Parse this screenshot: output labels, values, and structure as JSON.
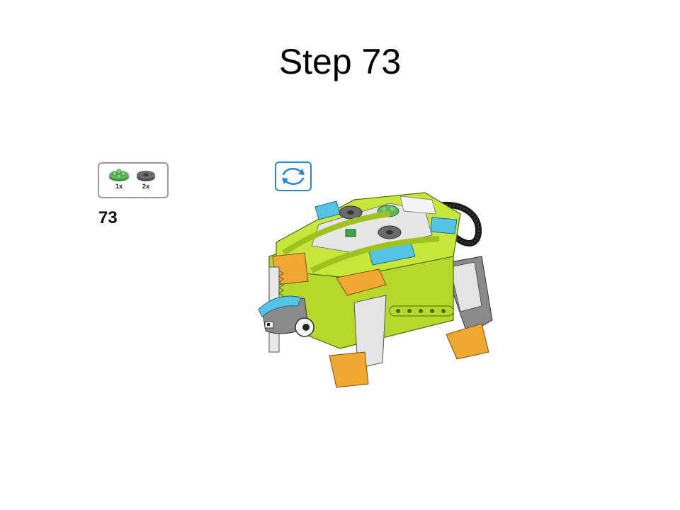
{
  "slide": {
    "title": "Step 73"
  },
  "parts_callout": {
    "parts": [
      {
        "qty": "1x",
        "color": "#5cb85c",
        "icon": "green-round-plate-icon"
      },
      {
        "qty": "2x",
        "color": "#6a6a6a",
        "icon": "gray-round-tile-icon"
      }
    ]
  },
  "step": {
    "number": "73"
  },
  "rotate": {
    "icon": "rotate-arrows-icon",
    "color": "#2a86c8"
  },
  "model": {
    "description": "turtle",
    "colors": {
      "lime": "#b5d82a",
      "azure": "#55c3e3",
      "orange": "#f0a830",
      "gray": "#8a8a8a",
      "white": "#f2f2f2"
    }
  }
}
